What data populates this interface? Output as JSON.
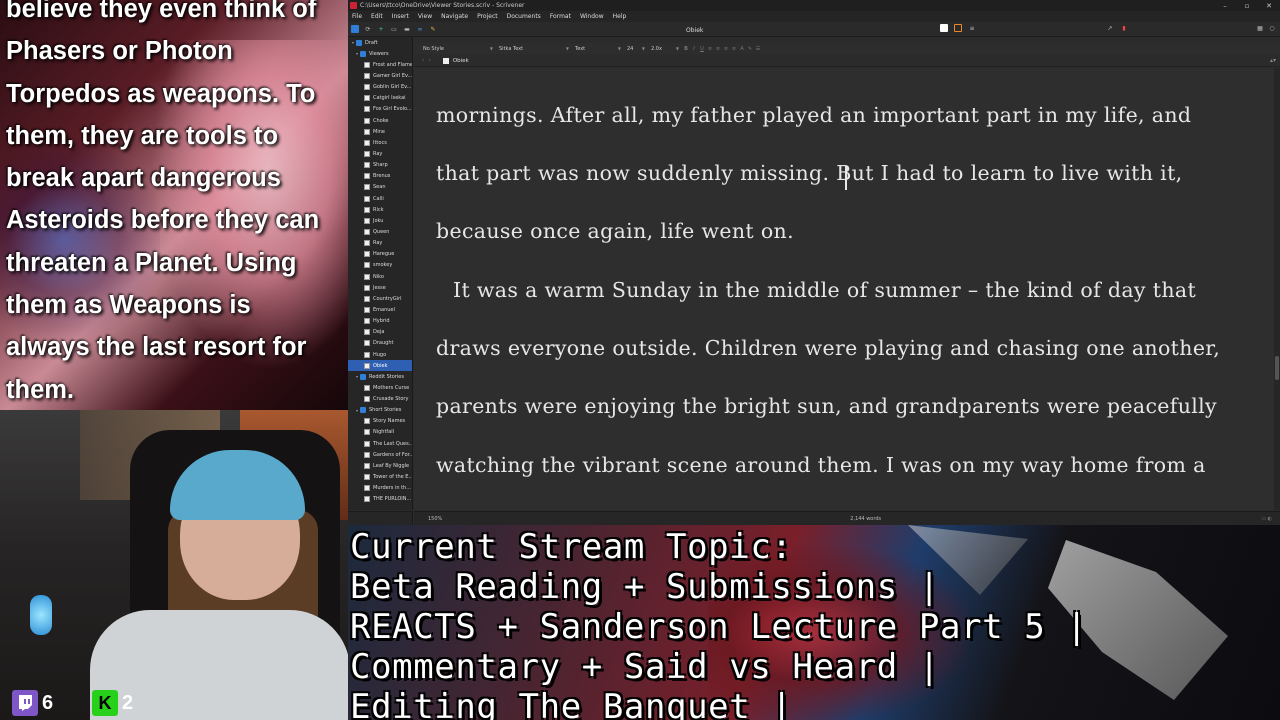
{
  "chat_overlay": {
    "lines": [
      "believe they even think of",
      "Phasers or Photon",
      "Torpedos as weapons. To",
      "them, they are tools to",
      "break apart dangerous",
      "Asteroids before they can",
      "threaten a Planet. Using",
      "them as Weapons is",
      "always the last resort for",
      "them."
    ]
  },
  "viewer_counts": {
    "twitch_icon": "twitch-icon",
    "twitch": "6",
    "kick_icon": "kick-icon",
    "kick_letter": "K",
    "kick": "2"
  },
  "window": {
    "title": "C:\\Users\\ttco\\OneDrive\\Viewer Stories.scriv - Scrivener",
    "controls": [
      "–",
      "▫",
      "✕"
    ]
  },
  "menu": [
    "File",
    "Edit",
    "Insert",
    "View",
    "Navigate",
    "Project",
    "Documents",
    "Format",
    "Window",
    "Help"
  ],
  "toolbar": {
    "center_title": "Obiek"
  },
  "binder": {
    "items": [
      {
        "label": "Draft",
        "level": 0,
        "type": "folder",
        "expanded": true
      },
      {
        "label": "Viewers",
        "level": 1,
        "type": "folder",
        "expanded": true
      },
      {
        "label": "Frost and Flame",
        "level": 2,
        "type": "doc"
      },
      {
        "label": "Gamer Girl Ev...",
        "level": 2,
        "type": "doc"
      },
      {
        "label": "Goblin Girl Ev...",
        "level": 2,
        "type": "doc"
      },
      {
        "label": "Catgirl Isekai",
        "level": 2,
        "type": "doc"
      },
      {
        "label": "Fox Girl Evolo...",
        "level": 2,
        "type": "doc"
      },
      {
        "label": "Choke",
        "level": 2,
        "type": "doc"
      },
      {
        "label": "Mine",
        "level": 2,
        "type": "doc"
      },
      {
        "label": "Ittocs",
        "level": 2,
        "type": "doc"
      },
      {
        "label": "Ray",
        "level": 2,
        "type": "doc"
      },
      {
        "label": "Sharp",
        "level": 2,
        "type": "doc"
      },
      {
        "label": "Brenus",
        "level": 2,
        "type": "doc"
      },
      {
        "label": "Sean",
        "level": 2,
        "type": "doc"
      },
      {
        "label": "Calli",
        "level": 2,
        "type": "doc"
      },
      {
        "label": "Rick",
        "level": 2,
        "type": "doc"
      },
      {
        "label": "Joku",
        "level": 2,
        "type": "doc"
      },
      {
        "label": "Queen",
        "level": 2,
        "type": "doc"
      },
      {
        "label": "Ray",
        "level": 2,
        "type": "doc"
      },
      {
        "label": "Haregue",
        "level": 2,
        "type": "doc"
      },
      {
        "label": "smokey",
        "level": 2,
        "type": "doc"
      },
      {
        "label": "Niko",
        "level": 2,
        "type": "doc"
      },
      {
        "label": "Jesse",
        "level": 2,
        "type": "doc"
      },
      {
        "label": "CountryGirl",
        "level": 2,
        "type": "doc"
      },
      {
        "label": "Emanuel",
        "level": 2,
        "type": "doc"
      },
      {
        "label": "Hybrid",
        "level": 2,
        "type": "doc"
      },
      {
        "label": "Deja",
        "level": 2,
        "type": "doc"
      },
      {
        "label": "Draught",
        "level": 2,
        "type": "doc"
      },
      {
        "label": "Hugo",
        "level": 2,
        "type": "doc"
      },
      {
        "label": "Obiek",
        "level": 2,
        "type": "doc",
        "selected": true
      },
      {
        "label": "Reddit Stories",
        "level": 1,
        "type": "folder",
        "expanded": true
      },
      {
        "label": "Mothers Curse",
        "level": 2,
        "type": "doc"
      },
      {
        "label": "Crusade Story",
        "level": 2,
        "type": "doc"
      },
      {
        "label": "Short Stories",
        "level": 1,
        "type": "folder",
        "expanded": true
      },
      {
        "label": "Story Names",
        "level": 2,
        "type": "doc"
      },
      {
        "label": "Nightfall",
        "level": 2,
        "type": "doc"
      },
      {
        "label": "The Last Ques...",
        "level": 2,
        "type": "doc"
      },
      {
        "label": "Gardens of For...",
        "level": 2,
        "type": "doc"
      },
      {
        "label": "Leaf By Niggle",
        "level": 2,
        "type": "doc"
      },
      {
        "label": "Tower of the E...",
        "level": 2,
        "type": "doc"
      },
      {
        "label": "Murders in th...",
        "level": 2,
        "type": "doc"
      },
      {
        "label": "THE PURLOIN...",
        "level": 2,
        "type": "doc"
      }
    ]
  },
  "format_bar": {
    "style": "No Style",
    "font": "Sitka Text",
    "typeface": "Text",
    "size": "24",
    "spacing": "2.0x"
  },
  "header": {
    "doc_title": "Obiek"
  },
  "editor": {
    "lines": [
      "mornings. After all, my father played an important part in my life, and",
      "that part was now suddenly missing. But I had to learn to live with it,",
      "because once again, life went on.",
      "It was a warm Sunday in the middle of summer – the kind of day that",
      "draws everyone outside. Children were playing and chasing one another,",
      "parents were enjoying the bright sun, and grandparents were peacefully",
      "watching the vibrant scene around them. I was on my way home from a"
    ]
  },
  "footer": {
    "zoom": "150%",
    "word_count": "2,144 words"
  },
  "stream_topic": {
    "lines": [
      "Current Stream Topic:",
      "Beta Reading + Submissions |",
      "REACTS + Sanderson Lecture Part 5 |",
      "Commentary + Said vs Heard |",
      "Editing The Banquet |"
    ]
  }
}
